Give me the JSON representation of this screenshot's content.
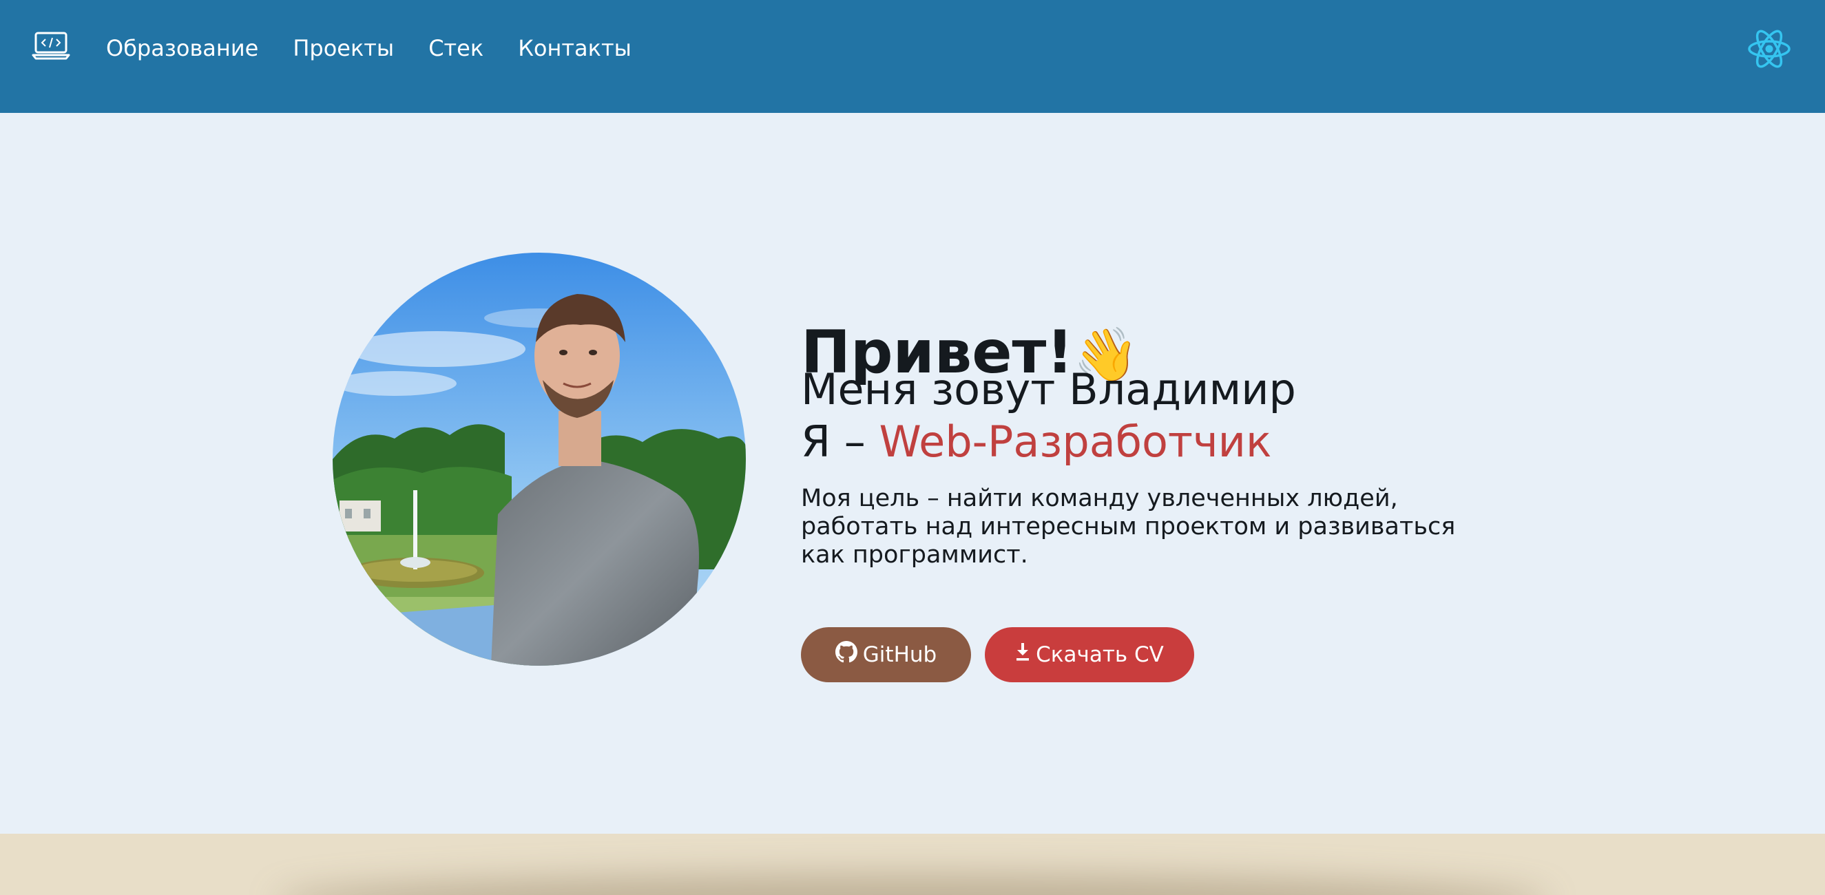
{
  "nav": {
    "links": [
      {
        "label": "Образование"
      },
      {
        "label": "Проекты"
      },
      {
        "label": "Стек"
      },
      {
        "label": "Контакты"
      }
    ]
  },
  "hero": {
    "greeting": "Привет!",
    "greeting_emoji": "👋",
    "name_line": "Меня зовут Владимир",
    "role_prefix": "Я – ",
    "role_accent": "Web-Разработчик",
    "goal": "Моя цель – найти команду увлеченных людей, работать над интересным проектом и развиваться как программист.",
    "buttons": {
      "github_label": "GitHub",
      "cv_label": "Скачать CV"
    }
  },
  "colors": {
    "nav_bg": "#2274a5",
    "page_bg": "#e8f0f8",
    "accent_red": "#c0403f",
    "github_btn": "#8b5a43",
    "cv_btn": "#c93d3d",
    "footer_band": "#e8dec8"
  },
  "icons": {
    "logo": "laptop-code-icon",
    "theme": "react-atom-icon",
    "github": "github-icon",
    "download": "download-icon"
  }
}
